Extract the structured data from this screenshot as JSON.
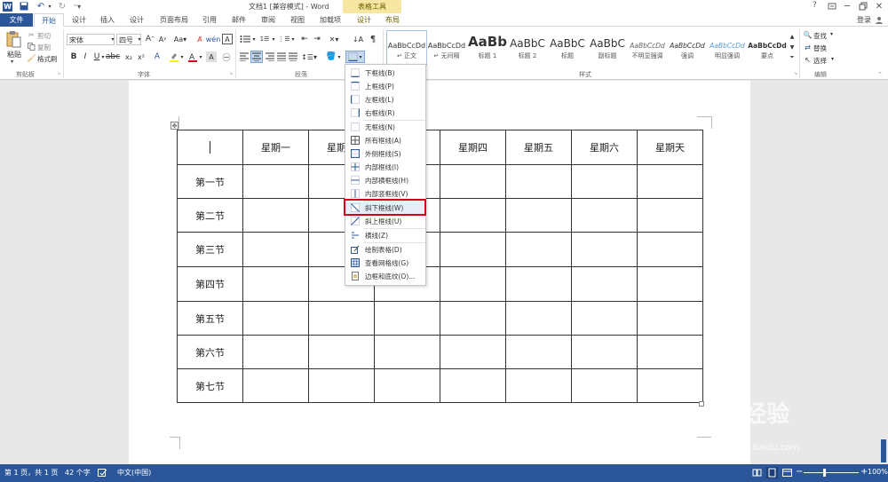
{
  "titlebar": {
    "doc_title": "文档1 [兼容模式] - Word",
    "context_group": "表格工具",
    "help": "?",
    "user": "登录"
  },
  "tabs": [
    "文件",
    "开始",
    "设计",
    "插入",
    "设计",
    "页面布局",
    "引用",
    "邮件",
    "审阅",
    "视图",
    "加载项",
    "设计",
    "布局"
  ],
  "clipboard": {
    "paste": "粘贴",
    "cut": "剪切",
    "copy": "复制",
    "format_painter": "格式刷",
    "label": "剪贴板"
  },
  "font": {
    "name": "宋体",
    "size": "四号",
    "label": "字体",
    "bold": "B",
    "italic": "I",
    "underline": "U"
  },
  "paragraph": {
    "label": "段落"
  },
  "styles": {
    "label": "样式",
    "items": [
      {
        "preview": "AaBbCcDd",
        "name": "↵ 正文"
      },
      {
        "preview": "AaBbCcDd",
        "name": "↵ 无间隔"
      },
      {
        "preview": "AaBb",
        "name": "标题 1"
      },
      {
        "preview": "AaBbC",
        "name": "标题 2"
      },
      {
        "preview": "AaBbC",
        "name": "标题"
      },
      {
        "preview": "AaBbC",
        "name": "副标题"
      },
      {
        "preview": "AaBbCcDd",
        "name": "不明显强调"
      },
      {
        "preview": "AaBbCcDd",
        "name": "强调"
      },
      {
        "preview": "AaBbCcDd",
        "name": "明显强调"
      },
      {
        "preview": "AaBbCcDd",
        "name": "要点"
      }
    ]
  },
  "editing": {
    "find": "查找",
    "replace": "替换",
    "select": "选择",
    "label": "编辑"
  },
  "table": {
    "headers": [
      "",
      "星期一",
      "星期",
      "",
      "星期四",
      "星期五",
      "星期六",
      "星期天"
    ],
    "rows": [
      "第一节",
      "第二节",
      "第三节",
      "第四节",
      "第五节",
      "第六节",
      "第七节"
    ]
  },
  "menu": {
    "items": [
      "下框线(B)",
      "上框线(P)",
      "左框线(L)",
      "右框线(R)",
      "无框线(N)",
      "所有框线(A)",
      "外侧框线(S)",
      "内部框线(I)",
      "内部横框线(H)",
      "内部竖框线(V)",
      "斜下框线(W)",
      "斜上框线(U)",
      "横线(Z)",
      "绘制表格(D)",
      "查看网格线(G)",
      "边框和底纹(O)..."
    ],
    "highlighted": "斜下框线(W)"
  },
  "status": {
    "page": "第 1 页，共 1 页",
    "words": "42 个字",
    "lang": "中文(中国)",
    "zoom": "100%"
  },
  "watermark": {
    "brand": "Baidu经验",
    "url": "jingyan.baidu.com"
  },
  "colors": {
    "word_blue": "#2b579a",
    "highlight_red": "#d9001b",
    "context_tab": "#f7e7a3"
  }
}
